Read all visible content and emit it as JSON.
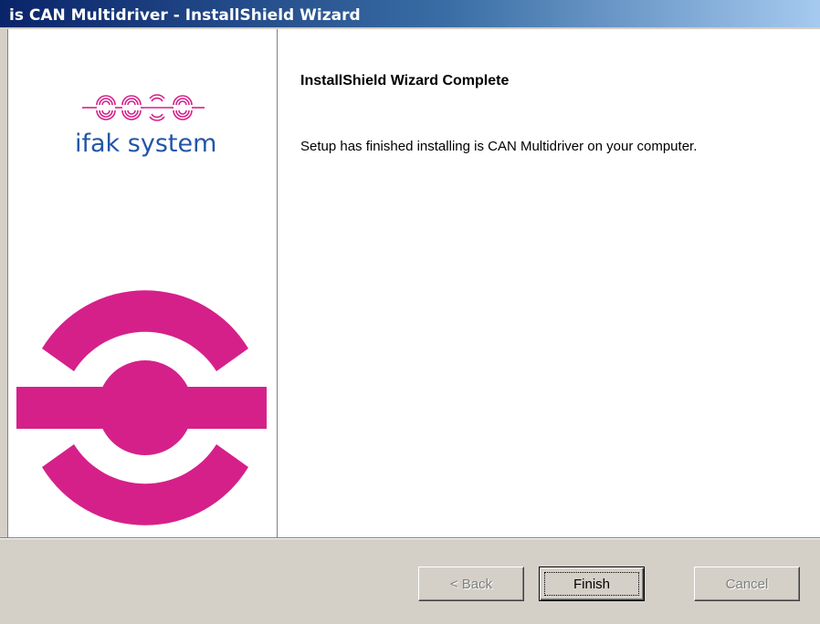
{
  "window": {
    "title": "is CAN Multidriver - InstallShield Wizard"
  },
  "brand": {
    "logo_text": "ifak system",
    "accent_color": "#d5208a",
    "text_color": "#2255a8"
  },
  "main": {
    "heading": "InstallShield Wizard Complete",
    "message": "Setup has finished installing is CAN Multidriver on your computer."
  },
  "buttons": {
    "back_label": "< Back",
    "finish_label": "Finish",
    "cancel_label": "Cancel"
  }
}
